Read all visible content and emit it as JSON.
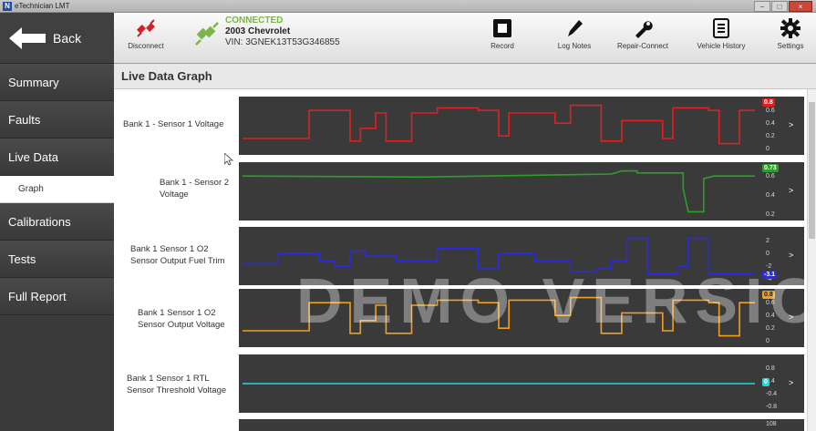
{
  "window": {
    "title": "eTechnician LMT",
    "minimize": "−",
    "maximize": "□",
    "close": "×"
  },
  "sidebar": {
    "back_label": "Back",
    "items": [
      {
        "label": "Summary"
      },
      {
        "label": "Faults"
      },
      {
        "label": "Live Data"
      },
      {
        "label": "Graph"
      },
      {
        "label": "Calibrations"
      },
      {
        "label": "Tests"
      },
      {
        "label": "Full Report"
      }
    ]
  },
  "toolbar": {
    "disconnect_label": "Disconnect",
    "connection_status": "CONNECTED",
    "vehicle": "2003 Chevrolet",
    "vin": "VIN: 3GNEK13T53G346855",
    "record_label": "Record",
    "log_notes_label": "Log Notes",
    "repair_connect_label": "Repair-Connect",
    "vehicle_history_label": "Vehicle History",
    "settings_label": "Settings"
  },
  "main": {
    "title": "Live Data Graph",
    "watermark": "DEMO VERSION"
  },
  "colors": {
    "red": "#e02020",
    "green": "#2aa02a",
    "blue": "#2a2ae0",
    "orange": "#f0a020",
    "cyan": "#22d8e0"
  },
  "graphs": [
    {
      "label": "Bank 1 - Sensor 1 Voltage",
      "color": "#e02020",
      "current": "0.8",
      "ticks": [
        "0.6",
        "0.4",
        "0.2",
        "0"
      ],
      "badge_color": "#e02020"
    },
    {
      "label": "Bank 1 - Sensor 2 Voltage",
      "color": "#2aa02a",
      "current": "0.73",
      "ticks": [
        "0.6",
        "0.4",
        "0.2"
      ],
      "badge_color": "#2aa02a"
    },
    {
      "label": "Bank 1 Sensor 1 O2 Sensor Output Fuel Trim",
      "color": "#2a2ae0",
      "current": "-3.1",
      "ticks": [
        "2",
        "0",
        "-2",
        "-4"
      ],
      "badge_color": "#2a2ae0"
    },
    {
      "label": "Bank 1 Sensor 1 O2 Sensor Output Voltage",
      "color": "#f0a020",
      "current": "0.8",
      "ticks": [
        "0.6",
        "0.4",
        "0.2",
        "0"
      ],
      "badge_color": "#f0a020"
    },
    {
      "label": "Bank 1 Sensor 1 RTL Sensor Threshold Voltage",
      "color": "#22d8e0",
      "current": "0",
      "ticks": [
        "0.8",
        "0.4",
        "-0.4",
        "-0.8"
      ],
      "badge_color": "#22d8e0"
    },
    {
      "label": "",
      "color": "#888888",
      "current": "",
      "ticks": [
        "108"
      ],
      "badge_color": "#888888"
    }
  ]
}
